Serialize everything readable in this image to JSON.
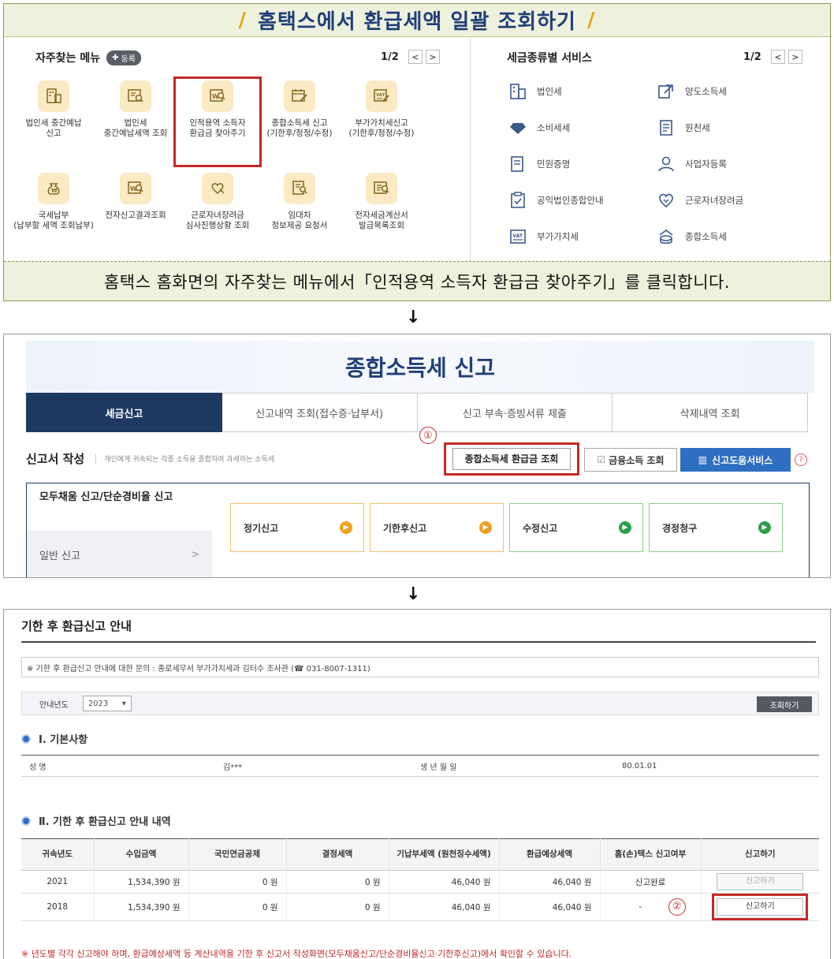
{
  "panel1": {
    "header_title": "홈택스에서 환급세액 일괄 조회하기",
    "header_slash": "/",
    "favorites": {
      "title": "자주찾는 메뉴",
      "register_label": "등록",
      "pager": "1/2",
      "items": [
        {
          "label1": "법인세 중간예납",
          "label2": "신고",
          "icon": "document-icon"
        },
        {
          "label1": "법인세",
          "label2": "중간예납세액 조회",
          "icon": "search-doc-icon"
        },
        {
          "label1": "인적용역 소득자",
          "label2": "환급금 찾아주기",
          "icon": "won-search-icon"
        },
        {
          "label1": "종합소득세 신고",
          "label2": "(기한후/정정/수정)",
          "icon": "calendar-pen-icon"
        },
        {
          "label1": "부가가치세신고",
          "label2": "(기한후/정정/수정)",
          "icon": "vat-pen-icon"
        },
        {
          "label1": "국세납부",
          "label2": "(납부할 세액 조회납부)",
          "icon": "money-bag-icon"
        },
        {
          "label1": "전자신고결과조회",
          "label2": "",
          "icon": "won-search-icon"
        },
        {
          "label1": "근로자녀장려금",
          "label2": "심사진행상황 조회",
          "icon": "heart-hand-icon"
        },
        {
          "label1": "임대차",
          "label2": "정보제공 요청서",
          "icon": "doc-search-icon"
        },
        {
          "label1": "전자세금계산서",
          "label2": "발급목록조회",
          "icon": "invoice-search-icon"
        }
      ]
    },
    "services": {
      "title": "세금종류별 서비스",
      "pager": "1/2",
      "items": [
        {
          "label": "법인세",
          "icon": "building-icon"
        },
        {
          "label": "양도소득세",
          "icon": "transfer-icon"
        },
        {
          "label": "소비세세",
          "icon": "diamond-icon"
        },
        {
          "label": "원천세",
          "icon": "receipt-icon"
        },
        {
          "label": "민원증명",
          "icon": "certificate-icon"
        },
        {
          "label": "사업자등록",
          "icon": "person-icon"
        },
        {
          "label": "공익법인종합안내",
          "icon": "clipboard-icon"
        },
        {
          "label": "근로자녀장려금",
          "icon": "heart-icon"
        },
        {
          "label": "부가가치세",
          "icon": "vat-icon"
        },
        {
          "label": "종합소득세",
          "icon": "coins-icon"
        }
      ]
    },
    "caption": "홈택스 홈화면의 자주찾는 메뉴에서「인적용역 소득자 환급금 찾아주기」를 클릭합니다."
  },
  "arrow": "↓",
  "panel2": {
    "banner_title": "종합소득세 신고",
    "tabs": [
      "세금신고",
      "신고내역 조회(접수증·납부서)",
      "신고 부속·증빙서류 제출",
      "삭제내역 조회"
    ],
    "subtitle": "신고서 작성",
    "description": "개인에게 귀속되는 각종 소득을 종합하여 과세하는 소득세",
    "step_mark": "①",
    "refund_button": "종합소득세 환급금 조회",
    "financial_button": "금융소득 조회",
    "help_button": "신고도움서비스",
    "help_q": "?",
    "side_active": "모두채움 신고/단순경비율 신고",
    "side_general": "일반 신고",
    "side_chevron": ">",
    "report_types": [
      "정기신고",
      "기한후신고",
      "수정신고",
      "경정청구"
    ]
  },
  "panel3": {
    "title": "기한 후 환급신고 안내",
    "notice": "※ 기한 후 환급신고 안내에 대한 문의 : 종로세무서 부가가치세과 김터수 조사관 (☎ 031-8007-1311)",
    "year_label": "안내년도",
    "year_value": "2023",
    "search_button": "조회하기",
    "section1": "Ⅰ. 기본사항",
    "basic": {
      "name_label": "성        명",
      "name_value": "김***",
      "birth_label": "생 년 월 일",
      "birth_value": "80.01.01"
    },
    "section2": "Ⅱ. 기한 후 환급신고 안내 내역",
    "table_headers": [
      "귀속년도",
      "수입금액",
      "국민연금공제",
      "결정세액",
      "기납부세액 (원천징수세액)",
      "환급예상세액",
      "홈(손)택스 신고여부",
      "신고하기"
    ],
    "rows": [
      {
        "year": "2021",
        "income": "1,534,390 원",
        "pension": "0 원",
        "tax": "0 원",
        "prepaid": "46,040 원",
        "refund": "46,040 원",
        "status": "신고완료",
        "action": "신고하기"
      },
      {
        "year": "2018",
        "income": "1,534,390 원",
        "pension": "0 원",
        "tax": "0 원",
        "prepaid": "46,040 원",
        "refund": "46,040 원",
        "status": "-",
        "action": "신고하기"
      }
    ],
    "step_mark": "②",
    "footer": "※ 년도별 각각 신고해야 하며, 환급예상세액 등 계산내역을 기한 후 신고서 작성화면(모두채움신고/단순경비율신고·기한후신고)에서 확인할 수 있습니다."
  },
  "colors": {
    "navy": "#1f3f7a",
    "highlight_red": "#c62828",
    "header_bg": "#eef2dc",
    "accent_blue": "#2f6fc2"
  }
}
